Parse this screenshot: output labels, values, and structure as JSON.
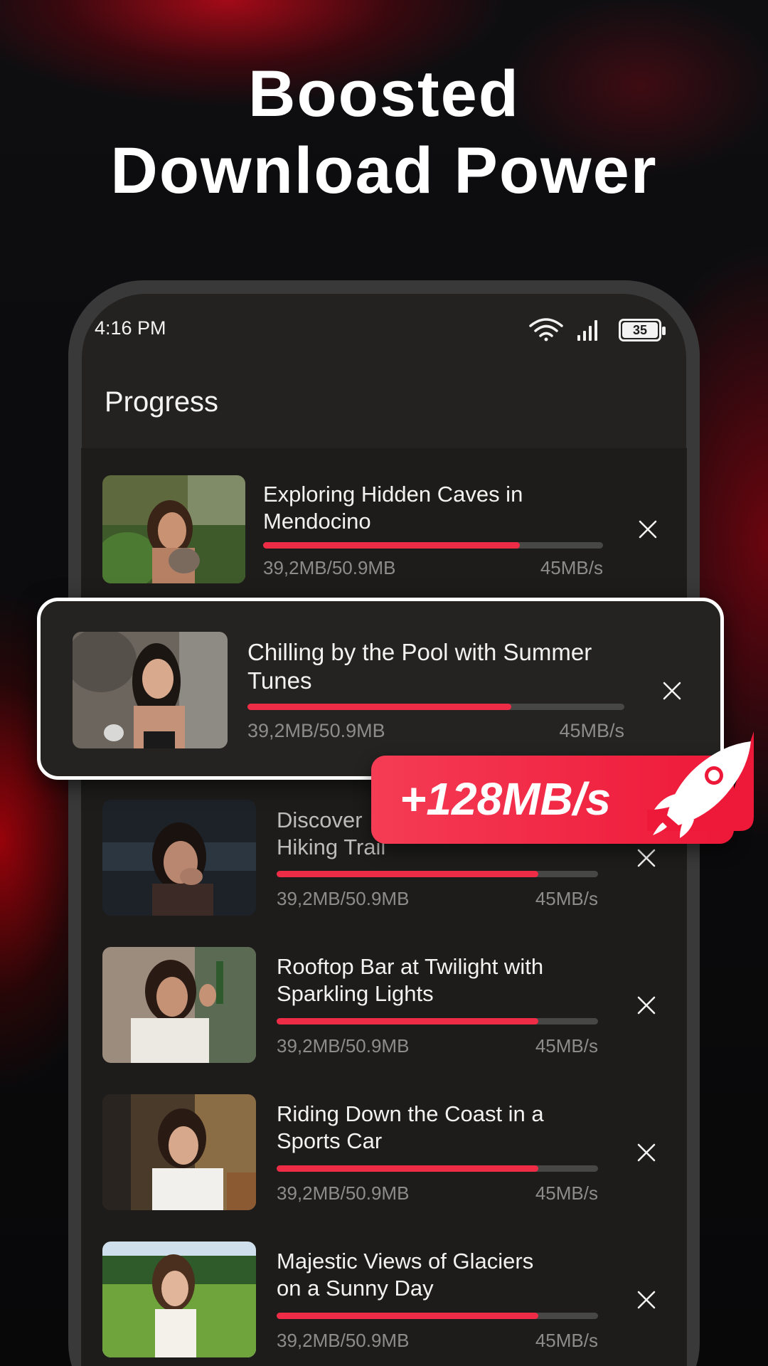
{
  "headline": {
    "line1": "Boosted",
    "line2": "Download Power"
  },
  "status_bar": {
    "time": "4:16 PM",
    "battery": "35",
    "icons": [
      "wifi-icon",
      "signal-icon",
      "battery-icon"
    ]
  },
  "page": {
    "title": "Progress"
  },
  "downloads": [
    {
      "title_line1": "Exploring Hidden Caves in",
      "title_line2": "Mendocino",
      "size": "39,2MB/50.9MB",
      "speed": "45MB/s",
      "progress": 0.755
    },
    {
      "title_line1": "Chilling by the Pool with Summer",
      "title_line2": "Tunes",
      "size": "39,2MB/50.9MB",
      "speed": "45MB/s",
      "progress": 0.7
    },
    {
      "title_line1": "Discover",
      "title_line2": "Hiking Trail",
      "size": "39,2MB/50.9MB",
      "speed": "45MB/s",
      "progress": 0.815
    },
    {
      "title_line1": "Rooftop Bar at Twilight with",
      "title_line2": "Sparkling Lights",
      "size": "39,2MB/50.9MB",
      "speed": "45MB/s",
      "progress": 0.815
    },
    {
      "title_line1": "Riding Down the Coast in a",
      "title_line2": "Sports Car",
      "size": "39,2MB/50.9MB",
      "speed": "45MB/s",
      "progress": 0.815
    },
    {
      "title_line1": "Majestic Views of Glaciers",
      "title_line2": "on a Sunny Day",
      "size": "39,2MB/50.9MB",
      "speed": "45MB/s",
      "progress": 0.815
    }
  ],
  "boost": {
    "label": "+128MB/s",
    "icon": "rocket-icon"
  },
  "colors": {
    "accent": "#ef2c46",
    "badge": "#f0213f",
    "track": "#474746"
  }
}
